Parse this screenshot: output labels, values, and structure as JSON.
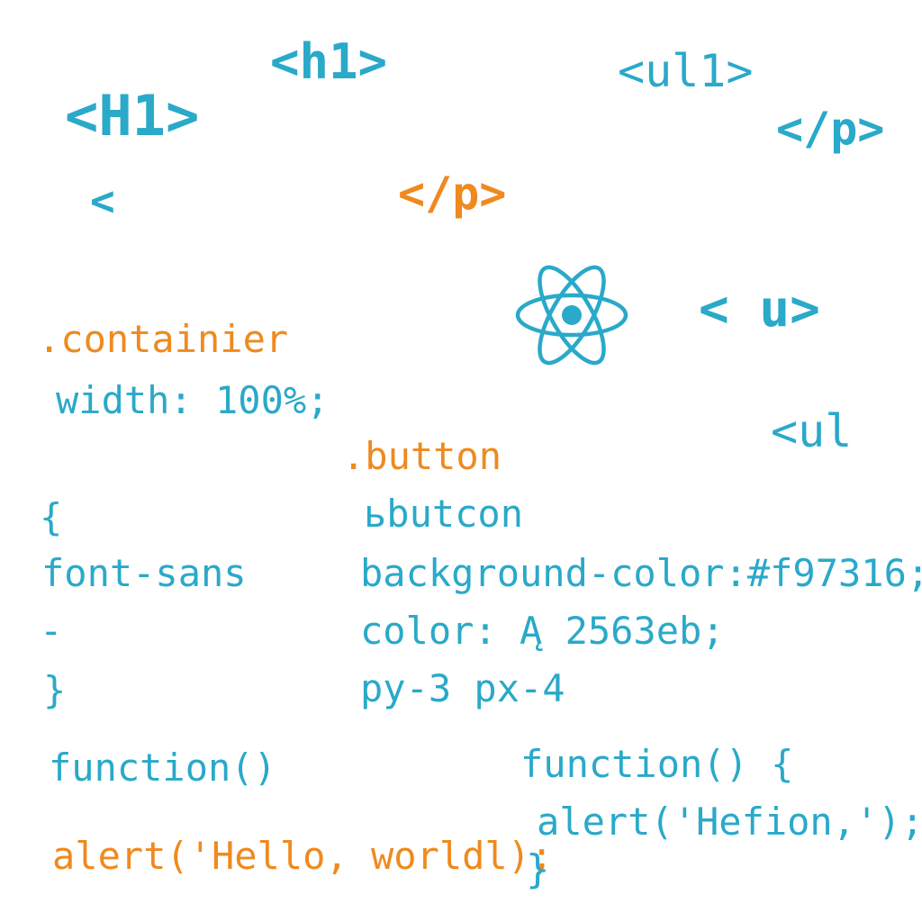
{
  "colors": {
    "blue": "#2aa9c9",
    "orange": "#ef8a1f",
    "background": "#ffffff"
  },
  "icon": "react-atom-logo",
  "snippets": {
    "h1_lower": "<h1>",
    "ul1_top": "<ul1>",
    "H1_upper": "<H1>",
    "p_close_right": "</p>",
    "lt_alone": "<",
    "p_close_orange": "</p>",
    "u_tag": "< u>",
    "container": ".containier",
    "width": "width: 100%;",
    "ul_open": "<ul",
    "button_class": ".button",
    "brace_open": "{",
    "bbutton": "ьbutcon",
    "font_sans": "font-sans",
    "bg_color": "background-color:#f97316;",
    "dash": "-",
    "color_line": "color: Ą 2563eb;",
    "brace_close": "}",
    "py_px": "py-3 px-4",
    "function_left": "function()",
    "function_right": "function() {",
    "alert_right": "alert('Hefion,');",
    "alert_left": "alert('Hello, worldl);",
    "brace_close_right": "}"
  }
}
